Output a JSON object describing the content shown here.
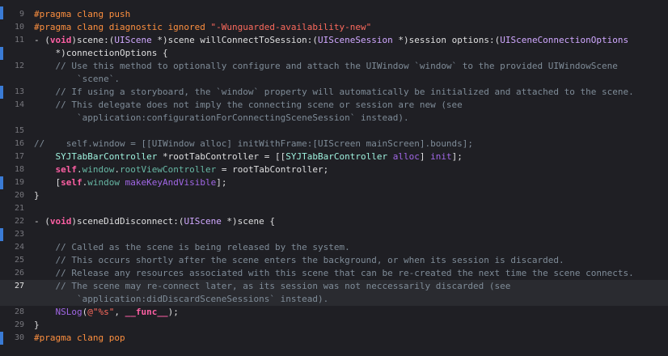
{
  "editor": {
    "current_line": 27,
    "lines": [
      {
        "num": "9",
        "tokens": [
          {
            "t": "#pragma clang push",
            "c": "pp"
          }
        ]
      },
      {
        "num": "10",
        "tokens": [
          {
            "t": "#pragma clang diagnostic ignored ",
            "c": "pp"
          },
          {
            "t": "\"-Wunguarded-availability-new\"",
            "c": "str"
          }
        ]
      },
      {
        "num": "11",
        "tokens": [
          {
            "t": "- (",
            "c": "pl"
          },
          {
            "t": "void",
            "c": "kw"
          },
          {
            "t": ")scene:(",
            "c": "pl"
          },
          {
            "t": "UIScene",
            "c": "ty"
          },
          {
            "t": " *)scene willConnectToSession:(",
            "c": "pl"
          },
          {
            "t": "UISceneSession",
            "c": "ty"
          },
          {
            "t": " *)session options:(",
            "c": "pl"
          },
          {
            "t": "UISceneConnectionOptions",
            "c": "ty"
          }
        ]
      },
      {
        "num": "",
        "tokens": [
          {
            "t": "    *)connectionOptions {",
            "c": "pl"
          }
        ]
      },
      {
        "num": "12",
        "tokens": [
          {
            "t": "    // Use this method to optionally configure and attach the UIWindow `window` to the provided UIWindowScene",
            "c": "cm"
          }
        ]
      },
      {
        "num": "",
        "tokens": [
          {
            "t": "        `scene`.",
            "c": "cm"
          }
        ]
      },
      {
        "num": "13",
        "tokens": [
          {
            "t": "    // If using a storyboard, the `window` property will automatically be initialized and attached to the scene.",
            "c": "cm"
          }
        ]
      },
      {
        "num": "14",
        "tokens": [
          {
            "t": "    // This delegate does not imply the connecting scene or session are new (see",
            "c": "cm"
          }
        ]
      },
      {
        "num": "",
        "tokens": [
          {
            "t": "        `application:configurationForConnectingSceneSession` instead).",
            "c": "cm"
          }
        ]
      },
      {
        "num": "15",
        "tokens": []
      },
      {
        "num": "16",
        "tokens": [
          {
            "t": "//    self.window = [[UIWindow alloc] initWithFrame:[UIScreen mainScreen].bounds];",
            "c": "cm"
          }
        ]
      },
      {
        "num": "17",
        "tokens": [
          {
            "t": "    ",
            "c": "pl"
          },
          {
            "t": "SYJTabBarController",
            "c": "pj"
          },
          {
            "t": " *rootTabController = [[",
            "c": "pl"
          },
          {
            "t": "SYJTabBarController",
            "c": "pj"
          },
          {
            "t": " ",
            "c": "pl"
          },
          {
            "t": "alloc",
            "c": "sys"
          },
          {
            "t": "] ",
            "c": "pl"
          },
          {
            "t": "init",
            "c": "sys"
          },
          {
            "t": "];",
            "c": "pl"
          }
        ]
      },
      {
        "num": "18",
        "tokens": [
          {
            "t": "    ",
            "c": "pl"
          },
          {
            "t": "self",
            "c": "kw"
          },
          {
            "t": ".",
            "c": "pl"
          },
          {
            "t": "window",
            "c": "pjm"
          },
          {
            "t": ".",
            "c": "pl"
          },
          {
            "t": "rootViewController",
            "c": "pjm"
          },
          {
            "t": " = rootTabController;",
            "c": "pl"
          }
        ]
      },
      {
        "num": "19",
        "tokens": [
          {
            "t": "    [",
            "c": "pl"
          },
          {
            "t": "self",
            "c": "kw"
          },
          {
            "t": ".",
            "c": "pl"
          },
          {
            "t": "window",
            "c": "pjm"
          },
          {
            "t": " ",
            "c": "pl"
          },
          {
            "t": "makeKeyAndVisible",
            "c": "sys"
          },
          {
            "t": "];",
            "c": "pl"
          }
        ]
      },
      {
        "num": "20",
        "tokens": [
          {
            "t": "}",
            "c": "pl"
          }
        ]
      },
      {
        "num": "21",
        "tokens": []
      },
      {
        "num": "22",
        "tokens": [
          {
            "t": "- (",
            "c": "pl"
          },
          {
            "t": "void",
            "c": "kw"
          },
          {
            "t": ")sceneDidDisconnect:(",
            "c": "pl"
          },
          {
            "t": "UIScene",
            "c": "ty"
          },
          {
            "t": " *)scene {",
            "c": "pl"
          }
        ]
      },
      {
        "num": "23",
        "tokens": []
      },
      {
        "num": "24",
        "tokens": [
          {
            "t": "    // Called as the scene is being released by the system.",
            "c": "cm"
          }
        ]
      },
      {
        "num": "25",
        "tokens": [
          {
            "t": "    // This occurs shortly after the scene enters the background, or when its session is discarded.",
            "c": "cm"
          }
        ]
      },
      {
        "num": "26",
        "tokens": [
          {
            "t": "    // Release any resources associated with this scene that can be re-created the next time the scene connects.",
            "c": "cm"
          }
        ]
      },
      {
        "num": "27",
        "tokens": [
          {
            "t": "    // The scene may re-connect later, as its session was not neccessarily discarded (see",
            "c": "cm"
          }
        ]
      },
      {
        "num": "",
        "tokens": [
          {
            "t": "        `application:didDiscardSceneSessions` instead).",
            "c": "cm"
          }
        ]
      },
      {
        "num": "28",
        "tokens": [
          {
            "t": "    ",
            "c": "pl"
          },
          {
            "t": "NSLog",
            "c": "sys"
          },
          {
            "t": "(",
            "c": "pl"
          },
          {
            "t": "@\"%s\"",
            "c": "str"
          },
          {
            "t": ", ",
            "c": "pl"
          },
          {
            "t": "__func__",
            "c": "kw"
          },
          {
            "t": ");",
            "c": "pl"
          }
        ]
      },
      {
        "num": "29",
        "tokens": [
          {
            "t": "}",
            "c": "pl"
          }
        ]
      },
      {
        "num": "30",
        "tokens": [
          {
            "t": "#pragma clang pop",
            "c": "pp"
          }
        ]
      }
    ]
  }
}
